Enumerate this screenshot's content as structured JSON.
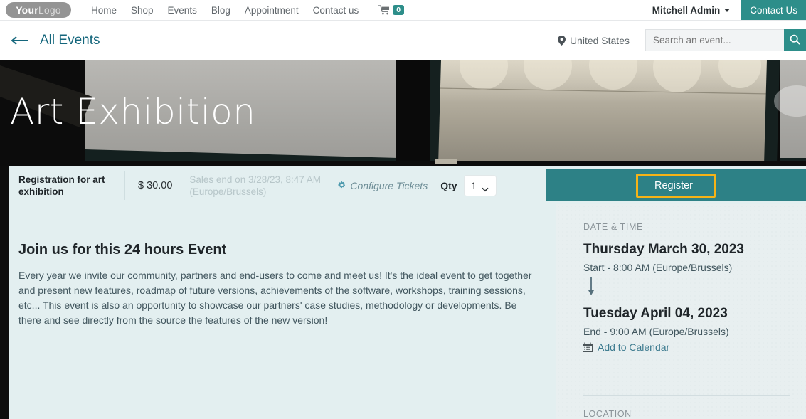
{
  "topnav": {
    "logo_bold": "Your",
    "logo_light": "Logo",
    "links": [
      {
        "label": "Home"
      },
      {
        "label": "Shop"
      },
      {
        "label": "Events"
      },
      {
        "label": "Blog"
      },
      {
        "label": "Appointment"
      },
      {
        "label": "Contact us"
      }
    ],
    "cart_count": "0",
    "user_name": "Mitchell Admin",
    "contact_button": "Contact Us"
  },
  "subnav": {
    "back_label": "All Events",
    "location": "United States",
    "search_placeholder": "Search an event...",
    "search_value": ""
  },
  "hero": {
    "title": "Art Exhibition"
  },
  "ticket": {
    "name": "Registration for art exhibition",
    "price": "$ 30.00",
    "sales_end": "Sales end on 3/28/23, 8:47 AM (Europe/Brussels)",
    "configure_label": "Configure Tickets",
    "qty_label": "Qty",
    "qty_value": "1",
    "register_label": "Register"
  },
  "main": {
    "heading": "Join us for this 24 hours Event",
    "paragraph": "Every year we invite our community, partners and end-users to come and meet us! It's the ideal event to get together and present new features, roadmap of future versions, achievements of the software, workshops, training sessions, etc... This event is also an opportunity to showcase our partners' case studies, methodology or developments. Be there and see directly from the source the features of the new version!"
  },
  "sidebar": {
    "datetime_label": "DATE & TIME",
    "start_date": "Thursday March 30, 2023",
    "start_time": "Start - 8:00 AM (Europe/Brussels)",
    "end_date": "Tuesday April 04, 2023",
    "end_time": "End - 9:00 AM (Europe/Brussels)",
    "add_to_calendar": "Add to Calendar",
    "location_label": "LOCATION"
  },
  "colors": {
    "brand_teal": "#2d8e8a",
    "register_teal": "#2d8186",
    "highlight_yellow": "#f5b317",
    "panel_bg": "#e3eff0",
    "sidebar_bg": "#e8eff0",
    "link_blue": "#14667c"
  }
}
